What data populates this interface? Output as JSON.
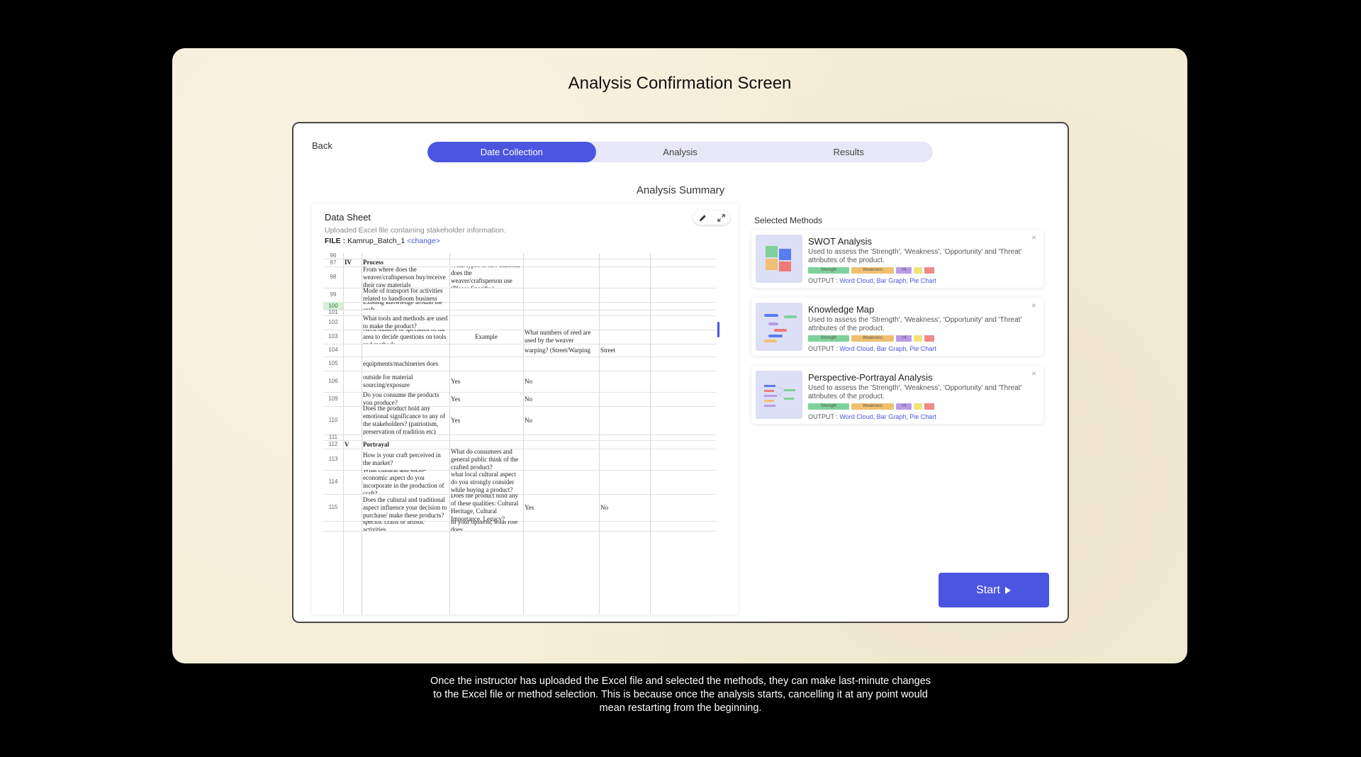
{
  "page_heading": "Analysis Confirmation Screen",
  "back_label": "Back",
  "steps": [
    {
      "label": "Date Collection",
      "active": true
    },
    {
      "label": "Analysis",
      "active": false
    },
    {
      "label": "Results",
      "active": false
    }
  ],
  "summary_title": "Analysis Summary",
  "data_sheet": {
    "title": "Data Sheet",
    "subtitle": "Uploaded Excel file containing stakeholder information.",
    "file_label": "FILE :",
    "file_name": "Kamrup_Batch_1",
    "change_label": "<change>",
    "icons": [
      "pencil-icon",
      "expand-icon"
    ],
    "rows": [
      {
        "num": "96",
        "cells": [
          "",
          "",
          "",
          "",
          ""
        ]
      },
      {
        "num": "97",
        "cells": [
          "IV",
          "Process",
          "",
          "",
          ""
        ]
      },
      {
        "num": "98",
        "cells": [
          "",
          "From where does the weaver/craftsperson buy/receive their raw materials",
          "What types of raw material does the weaver/craftsperson use (Please Specify )",
          "",
          ""
        ]
      },
      {
        "num": "99",
        "cells": [
          "",
          "Mode of transport for activities related to handloom business",
          "",
          "",
          ""
        ]
      },
      {
        "num": "100",
        "cells": [
          "",
          "Existing knowledge around the craft",
          "",
          "",
          ""
        ]
      },
      {
        "num": "101",
        "cells": [
          "",
          "",
          "",
          "",
          ""
        ]
      },
      {
        "num": "102",
        "cells": [
          "",
          "What tools and methods are used to make the product?",
          "",
          "",
          ""
        ]
      },
      {
        "num": "103",
        "cells": [
          "",
          "Need trainers or specialist of the area to decide questions on tools and methods",
          "Example",
          "What numbers of reed are used by the weaver",
          ""
        ]
      },
      {
        "num": "104",
        "cells": [
          "",
          "",
          "",
          "warping? (Street/Warping",
          "Street"
        ]
      },
      {
        "num": "105",
        "cells": [
          "",
          "equipments/machineries does",
          "",
          "",
          ""
        ]
      },
      {
        "num": "106",
        "cells": [
          "",
          "outside for material sourcing/exposure",
          "Yes",
          "No",
          ""
        ]
      },
      {
        "num": "109",
        "cells": [
          "",
          "Do you consume the products you produce?",
          "Yes",
          "No",
          ""
        ]
      },
      {
        "num": "110",
        "cells": [
          "",
          "Does the product hold any emotional significance to any of the stakeholders? (patriotism, preservation of tradition etc)",
          "Yes",
          "No",
          ""
        ]
      },
      {
        "num": "111",
        "cells": [
          "",
          "",
          "",
          "",
          ""
        ]
      },
      {
        "num": "112",
        "cells": [
          "V",
          "Portrayal",
          "",
          "",
          ""
        ]
      },
      {
        "num": "113",
        "cells": [
          "",
          "How is your craft perceived in the market?",
          "What do consumers and general public think of the crafted product?",
          "",
          ""
        ]
      },
      {
        "num": "114",
        "cells": [
          "",
          "What cultural and socio-economic aspect do you incorporate in the production of craft?",
          "what local cultural aspect do you strongly consider while buying a product?",
          "",
          ""
        ]
      },
      {
        "num": "115",
        "cells": [
          "",
          "Does the cultural and traditional aspect influence your decision to purchase/ make these products?",
          "Does the product hold any of these qualities: Cultural Heritage, Cultural Importance, Legacy?",
          "Yes",
          "No"
        ]
      },
      {
        "num": "",
        "cells": [
          "",
          "specific crafts or artistic activities",
          "In your opinion, what role does",
          "",
          ""
        ]
      }
    ]
  },
  "methods_title": "Selected Methods",
  "methods": [
    {
      "name": "SWOT Analysis",
      "desc": "Used to assess the 'Strength', 'Weakness', 'Opportunity' and 'Threat' attributes of the product.",
      "tags": [
        "Strength",
        "Weakness",
        "+4"
      ],
      "output_label": "OUTPUT :",
      "outputs": "Word Cloud, Bar Graph, Pie Chart",
      "thumb": "swot"
    },
    {
      "name": "Knowledge Map",
      "desc": "Used to assess the 'Strength', 'Weakness', 'Opportunity' and 'Threat' attributes of the product.",
      "tags": [
        "Strength",
        "Weakness",
        "+4"
      ],
      "output_label": "OUTPUT :",
      "outputs": "Word Cloud, Bar Graph, Pie Chart",
      "thumb": "kmap"
    },
    {
      "name": "Perspective-Portrayal Analysis",
      "desc": "Used to assess the 'Strength', 'Weakness', 'Opportunity' and 'Threat' attributes of the product.",
      "tags": [
        "Strength",
        "Weakness",
        "+4"
      ],
      "output_label": "OUTPUT :",
      "outputs": "Word Cloud, Bar Graph, Pie Chart",
      "thumb": "ppa"
    }
  ],
  "start_label": "Start",
  "caption": "Once the instructor has uploaded the Excel file and selected the methods, they can make last-minute changes to the Excel file or method selection. This is because once the analysis starts, cancelling it at any point would mean restarting from the beginning.",
  "colors": {
    "accent": "#4a55e0",
    "tag_strength": "#7ed19a",
    "tag_weakness": "#f0c070",
    "tag_more": "#b89be8",
    "tag_yellow": "#f2e27a",
    "tag_red": "#ee8a8a"
  }
}
